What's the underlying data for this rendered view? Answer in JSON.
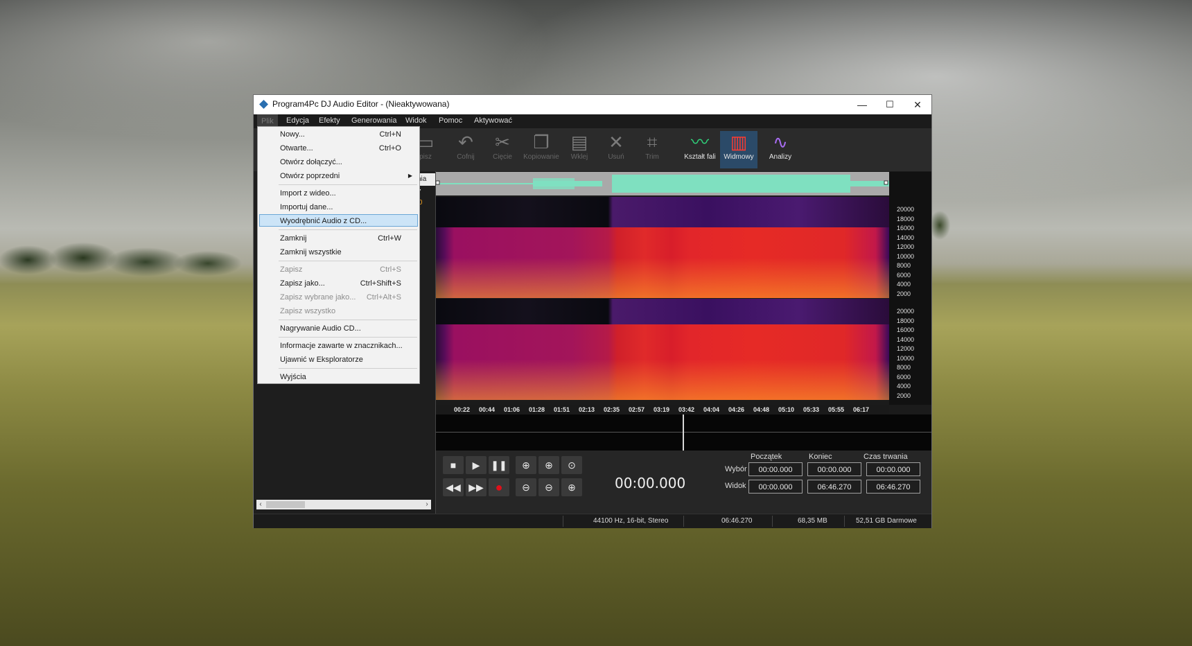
{
  "window": {
    "title": "Program4Pc DJ Audio Editor - (Nieaktywowana)",
    "controls": {
      "minimize": "—",
      "maximize": "☐",
      "close": "✕"
    }
  },
  "menubar": [
    "Plik",
    "Edycja",
    "Efekty",
    "Generowania",
    "Widok",
    "Pomoc",
    "Aktywować"
  ],
  "toolbar": {
    "partial_label": "pisz",
    "buttons": [
      {
        "label": "Cofnij",
        "icon": "undo-icon",
        "enabled": false
      },
      {
        "label": "Cięcie",
        "icon": "scissors-icon",
        "enabled": false
      },
      {
        "label": "Kopiowanie",
        "icon": "copy-icon",
        "enabled": false
      },
      {
        "label": "Wklej",
        "icon": "paste-icon",
        "enabled": false
      },
      {
        "label": "Usuń",
        "icon": "delete-icon",
        "enabled": false
      },
      {
        "label": "Trim",
        "icon": "crop-icon",
        "enabled": false
      },
      {
        "label": "Kształt fali",
        "icon": "waveform-icon",
        "enabled": true
      },
      {
        "label": "Widmowy",
        "icon": "spectrum-icon",
        "enabled": true,
        "selected": true
      },
      {
        "label": "Analizy",
        "icon": "analysis-icon",
        "enabled": true
      }
    ]
  },
  "file_list": {
    "column_partial": "nia",
    "values": [
      "7",
      "'0"
    ]
  },
  "file_menu": {
    "items": [
      {
        "label": "Nowy...",
        "shortcut": "Ctrl+N"
      },
      {
        "label": "Otwarte...",
        "shortcut": "Ctrl+O"
      },
      {
        "label": "Otwórz dołączyć...",
        "shortcut": ""
      },
      {
        "label": "Otwórz poprzedni",
        "shortcut": "",
        "submenu": true
      },
      {
        "label": "Import z wideo...",
        "shortcut": ""
      },
      {
        "label": "Importuj dane...",
        "shortcut": ""
      },
      {
        "label": "Wyodrębnić Audio z CD...",
        "shortcut": "",
        "highlighted": true
      },
      {
        "label": "Zamknij",
        "shortcut": "Ctrl+W"
      },
      {
        "label": "Zamknij wszystkie",
        "shortcut": ""
      },
      {
        "label": "Zapisz",
        "shortcut": "Ctrl+S",
        "disabled": true
      },
      {
        "label": "Zapisz jako...",
        "shortcut": "Ctrl+Shift+S"
      },
      {
        "label": "Zapisz wybrane jako...",
        "shortcut": "Ctrl+Alt+S",
        "disabled": true
      },
      {
        "label": "Zapisz wszystko",
        "shortcut": "",
        "disabled": true
      },
      {
        "label": "Nagrywanie Audio CD...",
        "shortcut": ""
      },
      {
        "label": "Informacje zawarte w znacznikach...",
        "shortcut": ""
      },
      {
        "label": "Ujawnić w Eksploratorze",
        "shortcut": ""
      },
      {
        "label": "Wyjścia",
        "shortcut": ""
      }
    ]
  },
  "frequency_axis": [
    "20000",
    "18000",
    "16000",
    "14000",
    "12000",
    "10000",
    "8000",
    "6000",
    "4000",
    "2000"
  ],
  "timeline": [
    "00:22",
    "00:44",
    "01:06",
    "01:28",
    "01:51",
    "02:13",
    "02:35",
    "02:57",
    "03:19",
    "03:42",
    "04:04",
    "04:26",
    "04:48",
    "05:10",
    "05:33",
    "05:55",
    "06:17"
  ],
  "transport": {
    "time": "00:00.000"
  },
  "selection": {
    "headers": [
      "Początek",
      "Koniec",
      "Czas trwania"
    ],
    "rows": [
      {
        "label": "Wybór",
        "values": [
          "00:00.000",
          "00:00.000",
          "00:00.000"
        ]
      },
      {
        "label": "Widok",
        "values": [
          "00:00.000",
          "06:46.270",
          "06:46.270"
        ]
      }
    ]
  },
  "status": {
    "format": "44100 Hz, 16-bit, Stereo",
    "duration": "06:46.270",
    "size": "68,35 MB",
    "free": "52,51 GB Darmowe"
  },
  "colors": {
    "waveform": "#7fe0c0",
    "selected_tool": "#2b4a68",
    "menu_highlight": "#cce4f7",
    "record": "#e0101a"
  }
}
